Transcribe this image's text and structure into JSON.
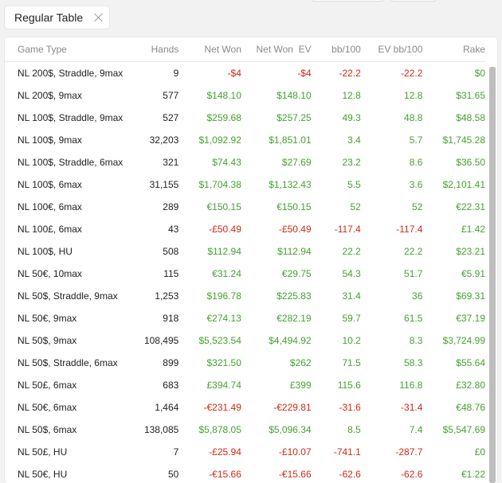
{
  "tab": {
    "label": "Regular Table"
  },
  "columns": [
    "Game Type",
    "Hands",
    "Net Won",
    "Net Won  EV",
    "bb/100",
    "EV bb/100",
    "Rake"
  ],
  "rows": [
    {
      "game": "NL 200$, Straddle, 9max",
      "hands": "9",
      "net_won": "-$4",
      "net_won_ev": "-$4",
      "bb100": "-22.2",
      "ev_bb100": "-22.2",
      "rake": "$0",
      "sign": [
        "neg",
        "neg",
        "neg",
        "neg",
        "pos"
      ]
    },
    {
      "game": "NL 200$, 9max",
      "hands": "577",
      "net_won": "$148.10",
      "net_won_ev": "$148.10",
      "bb100": "12.8",
      "ev_bb100": "12.8",
      "rake": "$31.65",
      "sign": [
        "pos",
        "pos",
        "pos",
        "pos",
        "pos"
      ]
    },
    {
      "game": "NL 100$, Straddle, 9max",
      "hands": "527",
      "net_won": "$259.68",
      "net_won_ev": "$257.25",
      "bb100": "49.3",
      "ev_bb100": "48.8",
      "rake": "$48.58",
      "sign": [
        "pos",
        "pos",
        "pos",
        "pos",
        "pos"
      ]
    },
    {
      "game": "NL 100$, 9max",
      "hands": "32,203",
      "net_won": "$1,092.92",
      "net_won_ev": "$1,851.01",
      "bb100": "3.4",
      "ev_bb100": "5.7",
      "rake": "$1,745.28",
      "sign": [
        "pos",
        "pos",
        "pos",
        "pos",
        "pos"
      ]
    },
    {
      "game": "NL 100$, Straddle, 6max",
      "hands": "321",
      "net_won": "$74.43",
      "net_won_ev": "$27.69",
      "bb100": "23.2",
      "ev_bb100": "8.6",
      "rake": "$36.50",
      "sign": [
        "pos",
        "pos",
        "pos",
        "pos",
        "pos"
      ]
    },
    {
      "game": "NL 100$, 6max",
      "hands": "31,155",
      "net_won": "$1,704.38",
      "net_won_ev": "$1,132.43",
      "bb100": "5.5",
      "ev_bb100": "3.6",
      "rake": "$2,101.41",
      "sign": [
        "pos",
        "pos",
        "pos",
        "pos",
        "pos"
      ]
    },
    {
      "game": "NL 100€, 6max",
      "hands": "289",
      "net_won": "€150.15",
      "net_won_ev": "€150.15",
      "bb100": "52",
      "ev_bb100": "52",
      "rake": "€22.31",
      "sign": [
        "pos",
        "pos",
        "pos",
        "pos",
        "pos"
      ]
    },
    {
      "game": "NL 100£, 6max",
      "hands": "43",
      "net_won": "-£50.49",
      "net_won_ev": "-£50.49",
      "bb100": "-117.4",
      "ev_bb100": "-117.4",
      "rake": "£1.42",
      "sign": [
        "neg",
        "neg",
        "neg",
        "neg",
        "pos"
      ]
    },
    {
      "game": "NL 100$, HU",
      "hands": "508",
      "net_won": "$112.94",
      "net_won_ev": "$112.94",
      "bb100": "22.2",
      "ev_bb100": "22.2",
      "rake": "$23.21",
      "sign": [
        "pos",
        "pos",
        "pos",
        "pos",
        "pos"
      ]
    },
    {
      "game": "NL 50€, 10max",
      "hands": "115",
      "net_won": "€31.24",
      "net_won_ev": "€29.75",
      "bb100": "54.3",
      "ev_bb100": "51.7",
      "rake": "€5.91",
      "sign": [
        "pos",
        "pos",
        "pos",
        "pos",
        "pos"
      ]
    },
    {
      "game": "NL 50$, Straddle, 9max",
      "hands": "1,253",
      "net_won": "$196.78",
      "net_won_ev": "$225.83",
      "bb100": "31.4",
      "ev_bb100": "36",
      "rake": "$69.31",
      "sign": [
        "pos",
        "pos",
        "pos",
        "pos",
        "pos"
      ]
    },
    {
      "game": "NL 50€, 9max",
      "hands": "918",
      "net_won": "€274.13",
      "net_won_ev": "€282.19",
      "bb100": "59.7",
      "ev_bb100": "61.5",
      "rake": "€37.19",
      "sign": [
        "pos",
        "pos",
        "pos",
        "pos",
        "pos"
      ]
    },
    {
      "game": "NL 50$, 9max",
      "hands": "108,495",
      "net_won": "$5,523.54",
      "net_won_ev": "$4,494.92",
      "bb100": "10.2",
      "ev_bb100": "8.3",
      "rake": "$3,724.99",
      "sign": [
        "pos",
        "pos",
        "pos",
        "pos",
        "pos"
      ]
    },
    {
      "game": "NL 50$, Straddle, 6max",
      "hands": "899",
      "net_won": "$321.50",
      "net_won_ev": "$262",
      "bb100": "71.5",
      "ev_bb100": "58.3",
      "rake": "$55.64",
      "sign": [
        "pos",
        "pos",
        "pos",
        "pos",
        "pos"
      ]
    },
    {
      "game": "NL 50£, 6max",
      "hands": "683",
      "net_won": "£394.74",
      "net_won_ev": "£399",
      "bb100": "115.6",
      "ev_bb100": "116.8",
      "rake": "£32.80",
      "sign": [
        "pos",
        "pos",
        "pos",
        "pos",
        "pos"
      ]
    },
    {
      "game": "NL 50€, 6max",
      "hands": "1,464",
      "net_won": "-€231.49",
      "net_won_ev": "-€229.81",
      "bb100": "-31.6",
      "ev_bb100": "-31.4",
      "rake": "€48.76",
      "sign": [
        "neg",
        "neg",
        "neg",
        "neg",
        "pos"
      ]
    },
    {
      "game": "NL 50$, 6max",
      "hands": "138,085",
      "net_won": "$5,878.05",
      "net_won_ev": "$5,096.34",
      "bb100": "8.5",
      "ev_bb100": "7.4",
      "rake": "$5,547.69",
      "sign": [
        "pos",
        "pos",
        "pos",
        "pos",
        "pos"
      ]
    },
    {
      "game": "NL 50£, HU",
      "hands": "7",
      "net_won": "-£25.94",
      "net_won_ev": "-£10.07",
      "bb100": "-741.1",
      "ev_bb100": "-287.7",
      "rake": "£0",
      "sign": [
        "neg",
        "neg",
        "neg",
        "neg",
        "pos"
      ]
    },
    {
      "game": "NL 50€, HU",
      "hands": "50",
      "net_won": "-€15.66",
      "net_won_ev": "-€15.66",
      "bb100": "-62.6",
      "ev_bb100": "-62.6",
      "rake": "€1.22",
      "sign": [
        "neg",
        "neg",
        "neg",
        "neg",
        "pos"
      ]
    }
  ],
  "colors": {
    "positive": "#43a32f",
    "negative": "#cf2a14",
    "header": "#8a8a8a"
  }
}
